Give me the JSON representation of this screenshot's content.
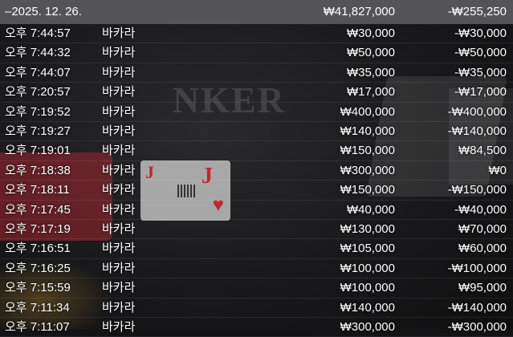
{
  "summary": {
    "date": "–2025. 12. 26.",
    "total_bet": "₩41,827,000",
    "total_result": "-₩255,250"
  },
  "background": {
    "banner_text": "NKER"
  },
  "rows": [
    {
      "time": "오후 7:44:57",
      "game": "바카라",
      "bet": "₩30,000",
      "result": "-₩30,000"
    },
    {
      "time": "오후 7:44:32",
      "game": "바카라",
      "bet": "₩50,000",
      "result": "-₩50,000"
    },
    {
      "time": "오후 7:44:07",
      "game": "바카라",
      "bet": "₩35,000",
      "result": "-₩35,000"
    },
    {
      "time": "오후 7:20:57",
      "game": "바카라",
      "bet": "₩17,000",
      "result": "-₩17,000"
    },
    {
      "time": "오후 7:19:52",
      "game": "바카라",
      "bet": "₩400,000",
      "result": "-₩400,000"
    },
    {
      "time": "오후 7:19:27",
      "game": "바카라",
      "bet": "₩140,000",
      "result": "-₩140,000"
    },
    {
      "time": "오후 7:19:01",
      "game": "바카라",
      "bet": "₩150,000",
      "result": "₩84,500"
    },
    {
      "time": "오후 7:18:38",
      "game": "바카라",
      "bet": "₩300,000",
      "result": "₩0"
    },
    {
      "time": "오후 7:18:11",
      "game": "바카라",
      "bet": "₩150,000",
      "result": "-₩150,000"
    },
    {
      "time": "오후 7:17:45",
      "game": "바카라",
      "bet": "₩40,000",
      "result": "-₩40,000"
    },
    {
      "time": "오후 7:17:19",
      "game": "바카라",
      "bet": "₩130,000",
      "result": "₩70,000"
    },
    {
      "time": "오후 7:16:51",
      "game": "바카라",
      "bet": "₩105,000",
      "result": "₩60,000"
    },
    {
      "time": "오후 7:16:25",
      "game": "바카라",
      "bet": "₩100,000",
      "result": "-₩100,000"
    },
    {
      "time": "오후 7:15:59",
      "game": "바카라",
      "bet": "₩100,000",
      "result": "₩95,000"
    },
    {
      "time": "오후 7:11:34",
      "game": "바카라",
      "bet": "₩140,000",
      "result": "-₩140,000"
    },
    {
      "time": "오후 7:11:07",
      "game": "바카라",
      "bet": "₩300,000",
      "result": "-₩300,000"
    }
  ]
}
